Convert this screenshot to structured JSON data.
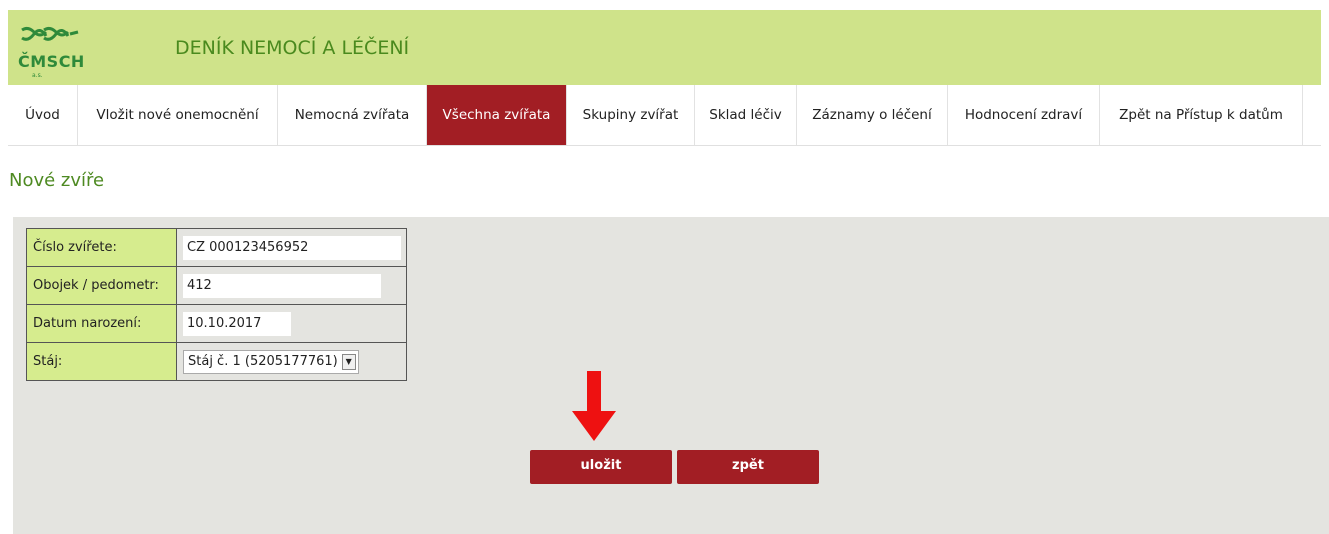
{
  "header": {
    "logo_text": "ČMSCH",
    "logo_sub": "a.s.",
    "title": "DENÍK NEMOCÍ A LÉČENÍ",
    "accent_color": "#cfe38a"
  },
  "nav": {
    "items": [
      {
        "label": "Úvod"
      },
      {
        "label": "Vložit nové onemocnění"
      },
      {
        "label": "Nemocná zvířata"
      },
      {
        "label": "Všechna zvířata"
      },
      {
        "label": "Skupiny zvířat"
      },
      {
        "label": "Sklad léčiv"
      },
      {
        "label": "Záznamy o léčení"
      },
      {
        "label": "Hodnocení zdraví"
      },
      {
        "label": "Zpět na Přístup k datům"
      }
    ],
    "active": "Všechna zvířata",
    "active_color": "#a21e24"
  },
  "page": {
    "title": "Nové zvíře"
  },
  "form": {
    "animal_number_label": "Číslo zvířete:",
    "animal_number_prefix": "CZ",
    "animal_number_value": "000123456952",
    "collar_label": "Obojek / pedometr:",
    "collar_value": "412",
    "birth_date_label": "Datum narození:",
    "birth_date_value": "10.10.2017",
    "barn_label": "Stáj:",
    "barn_value": "Stáj č. 1 (5205177761)"
  },
  "buttons": {
    "save_label": "uložit",
    "back_label": "zpět"
  },
  "annotation": {
    "arrow_icon": "down-arrow-icon",
    "arrow_color": "#ee1111"
  }
}
